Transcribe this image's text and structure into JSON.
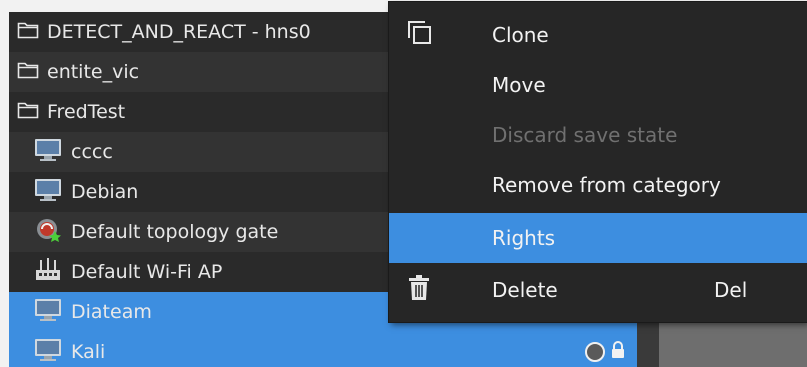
{
  "tree": {
    "rows": [
      {
        "label": "DETECT_AND_REACT - hns0",
        "type": "folder"
      },
      {
        "label": "entite_vic",
        "type": "folder"
      },
      {
        "label": "FredTest",
        "type": "folder"
      },
      {
        "label": "cccc",
        "type": "monitor"
      },
      {
        "label": "Debian",
        "type": "monitor"
      },
      {
        "label": "Default topology gate",
        "type": "gateway"
      },
      {
        "label": "Default Wi-Fi AP",
        "type": "wifi-ap"
      },
      {
        "label": "Diateam",
        "type": "monitor",
        "selected": true
      },
      {
        "label": "Kali",
        "type": "monitor",
        "selected": true
      }
    ]
  },
  "context_menu": {
    "items": [
      {
        "label": "Clone",
        "icon": "clone-icon"
      },
      {
        "label": "Move"
      },
      {
        "label": "Discard save state",
        "disabled": true
      },
      {
        "label": "Remove from category"
      },
      {
        "label": "Rights",
        "highlighted": true
      },
      {
        "label": "Delete",
        "icon": "trash-icon",
        "shortcut": "Del"
      }
    ]
  },
  "colors": {
    "selection": "#3d8ee0",
    "menu_bg": "#262626",
    "row_dark": "#2a2a2a",
    "row_light": "#333333",
    "disabled_text": "#707070"
  }
}
